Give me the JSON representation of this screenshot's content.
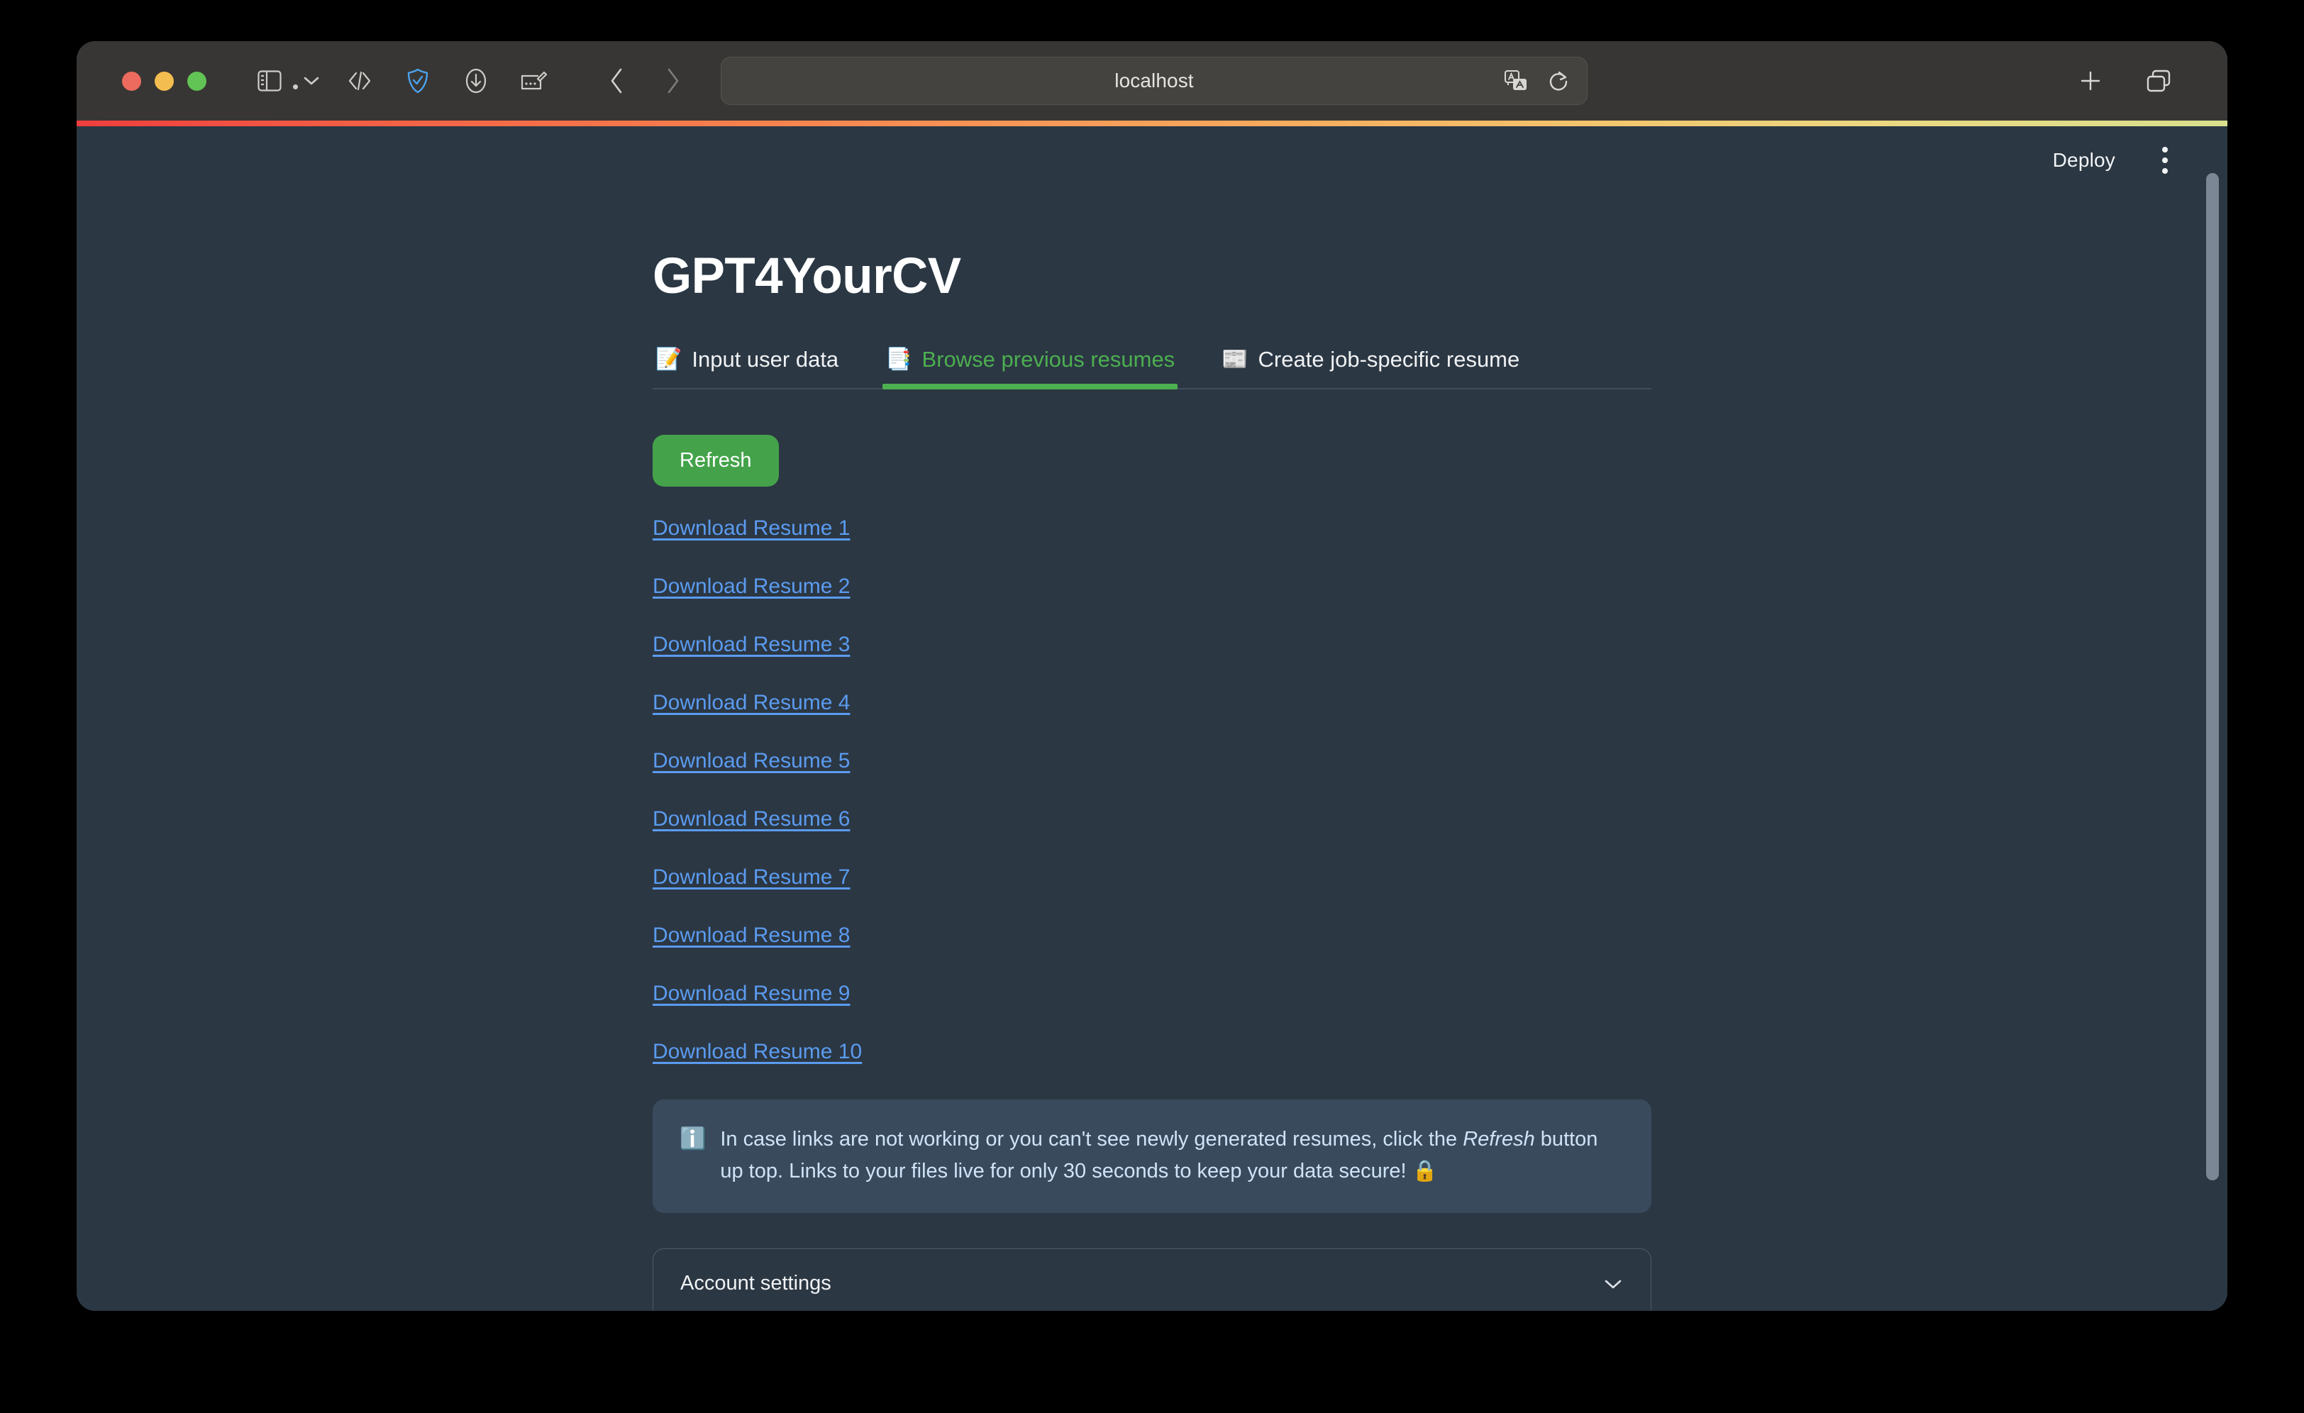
{
  "browser": {
    "traffic_lights": [
      "close",
      "minimize",
      "maximize"
    ],
    "url_value": "localhost",
    "url_placeholder": "Search or enter website name",
    "toolbar_icons": [
      "sidebar-icon",
      "chevron-down-icon",
      "code-icon",
      "shield-check-icon",
      "download-icon",
      "notes-icon",
      "back-icon",
      "forward-icon",
      "translate-icon",
      "reload-icon",
      "new-tab-icon",
      "tab-overview-icon"
    ]
  },
  "app": {
    "header": {
      "deploy_label": "Deploy",
      "menu_icon": "kebab-menu-icon"
    },
    "title": "GPT4YourCV",
    "tabs": [
      {
        "emoji": "📝",
        "label": "Input user data",
        "active": false,
        "icon_name": "memo-emoji"
      },
      {
        "emoji": "📑",
        "label": "Browse previous resumes",
        "active": true,
        "icon_name": "bookmark-tabs-emoji"
      },
      {
        "emoji": "📰",
        "label": "Create job-specific resume",
        "active": false,
        "icon_name": "newspaper-emoji"
      }
    ],
    "refresh_button": "Refresh",
    "download_links": [
      "Download Resume 1",
      "Download Resume 2",
      "Download Resume 3",
      "Download Resume 4",
      "Download Resume 5",
      "Download Resume 6",
      "Download Resume 7",
      "Download Resume 8",
      "Download Resume 9",
      "Download Resume 10"
    ],
    "info_box": {
      "icon": "ℹ️",
      "text_before_em": "In case links are not working or you can't see newly generated resumes, click the ",
      "em_text": "Refresh",
      "text_after_em": " button up top. Links to your files live for only 30 seconds to keep your data secure! 🔒"
    },
    "expander": {
      "label": "Account settings",
      "chevron": "chevron-down-icon",
      "expanded": false
    }
  },
  "colors": {
    "page_background": "#2b3743",
    "toolbar_background": "#383634",
    "accent_green": "#4caf50",
    "refresh_green": "#44a34a",
    "link_blue": "#5b9bf0",
    "info_background": "#3a4a5d",
    "info_text": "#cfe3f7",
    "scrollbar_thumb": "#7b8794"
  }
}
